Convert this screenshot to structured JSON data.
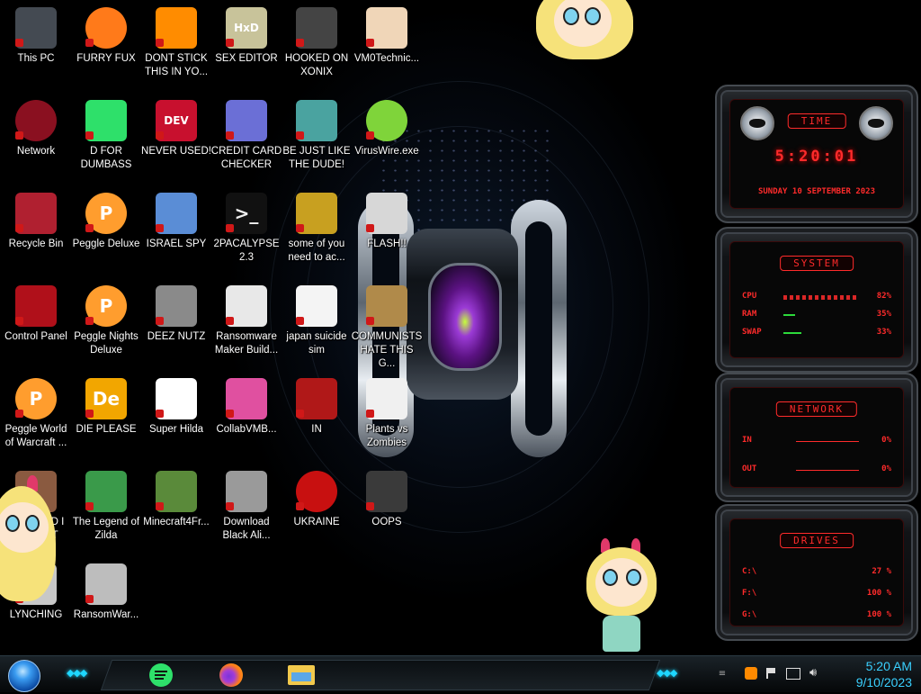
{
  "desktop": {
    "icons": [
      {
        "label": "This PC",
        "icon": "computer-icon"
      },
      {
        "label": "FURRY FUX",
        "icon": "firefox-icon"
      },
      {
        "label": "DONT STICK THIS IN YO...",
        "icon": "vlc-cone-icon"
      },
      {
        "label": "SEX EDITOR",
        "icon": "hxd-icon"
      },
      {
        "label": "HOOKED ON XONIX",
        "icon": "xonix-icon"
      },
      {
        "label": "VM0Technic...",
        "icon": "doctor-icon"
      },
      {
        "label": "Network",
        "icon": "network-icon"
      },
      {
        "label": "D FOR DUMBASS",
        "icon": "discord-icon"
      },
      {
        "label": "NEVER USED!",
        "icon": "devcpp-icon"
      },
      {
        "label": "CREDIT CARD CHECKER",
        "icon": "credit-card-icon"
      },
      {
        "label": "BE JUST LIKE THE DUDE!",
        "icon": "elf-icon"
      },
      {
        "label": "VirusWire.exe",
        "icon": "limewire-icon"
      },
      {
        "label": "Recycle Bin",
        "icon": "recycle-bin-icon"
      },
      {
        "label": "Peggle Deluxe",
        "icon": "peggle-icon"
      },
      {
        "label": "ISRAEL SPY",
        "icon": "spy-network-icon"
      },
      {
        "label": "2PACALYPSE 2.3",
        "icon": "terminal-icon"
      },
      {
        "label": "some of you need to ac...",
        "icon": "beaver-icon"
      },
      {
        "label": "FLASH!!",
        "icon": "flash-icon"
      },
      {
        "label": "Control Panel",
        "icon": "control-panel-icon"
      },
      {
        "label": "Peggle Nights Deluxe",
        "icon": "peggle-icon"
      },
      {
        "label": "DEEZ NUTZ",
        "icon": "window-stack-icon"
      },
      {
        "label": "Ransomware Maker Build...",
        "icon": "builder-icon"
      },
      {
        "label": "japan suicide sim",
        "icon": "document-icon"
      },
      {
        "label": "COMMUNISTS HATE THIS G...",
        "icon": "money-bag-icon"
      },
      {
        "label": "Peggle World of Warcraft ...",
        "icon": "peggle-icon"
      },
      {
        "label": "DIE PLEASE",
        "icon": "de-icon"
      },
      {
        "label": "Super Hilda",
        "icon": "pixel-character-icon"
      },
      {
        "label": "CollabVMB...",
        "icon": "collabvm-icon"
      },
      {
        "label": "IN",
        "icon": "hidden-icon"
      },
      {
        "label": "Plants vs Zombies",
        "icon": "flower-icon"
      },
      {
        "label": "OOPS DID I DO THAT",
        "icon": "portrait-icon"
      },
      {
        "label": "The Legend of Zilda",
        "icon": "link-character-icon"
      },
      {
        "label": "Minecraft4Fr...",
        "icon": "grass-block-icon"
      },
      {
        "label": "Download Black Ali...",
        "icon": "alien-icon"
      },
      {
        "label": "UKRAINE",
        "icon": "radiation-icon"
      },
      {
        "label": "OOPS",
        "icon": "alienware-icon"
      },
      {
        "label": "LYNCHING",
        "icon": "lynching-icon"
      },
      {
        "label": "RansomWar...",
        "icon": "skull-icon"
      }
    ]
  },
  "widgets": {
    "time": {
      "title": "TIME",
      "clock": "5:20:01",
      "date": "SUNDAY 10 SEPTEMBER 2023"
    },
    "system": {
      "title": "SYSTEM",
      "rows": [
        {
          "key": "CPU",
          "value": "82%",
          "level": 0.82
        },
        {
          "key": "RAM",
          "value": "35%",
          "level": 0.35
        },
        {
          "key": "SWAP",
          "value": "33%",
          "level": 0.33
        }
      ]
    },
    "network": {
      "title": "NETWORK",
      "rows": [
        {
          "key": "IN",
          "value": "0%"
        },
        {
          "key": "OUT",
          "value": "0%"
        }
      ]
    },
    "drives": {
      "title": "DRIVES",
      "rows": [
        {
          "key": "C:\\",
          "value": "27 %",
          "level": 0.27
        },
        {
          "key": "F:\\",
          "value": "100 %",
          "level": 1.0
        },
        {
          "key": "G:\\",
          "value": "100 %",
          "level": 1.0
        }
      ]
    }
  },
  "taskbar": {
    "pinned": [
      {
        "name": "discord-icon",
        "color": "#2ee06a"
      },
      {
        "name": "firefox-icon",
        "color": "#ff7a1a"
      },
      {
        "name": "file-explorer-icon",
        "color": "#f2c94c"
      }
    ],
    "tray_icons": [
      "sublime-icon",
      "flag-icon",
      "network-icon",
      "volume-icon"
    ],
    "clock": {
      "time": "5:20 AM",
      "date": "9/10/2023"
    }
  },
  "colors": {
    "accent": "#ff2b2b",
    "clock": "#3ad0ff",
    "chevron": "#1ed7ff"
  }
}
